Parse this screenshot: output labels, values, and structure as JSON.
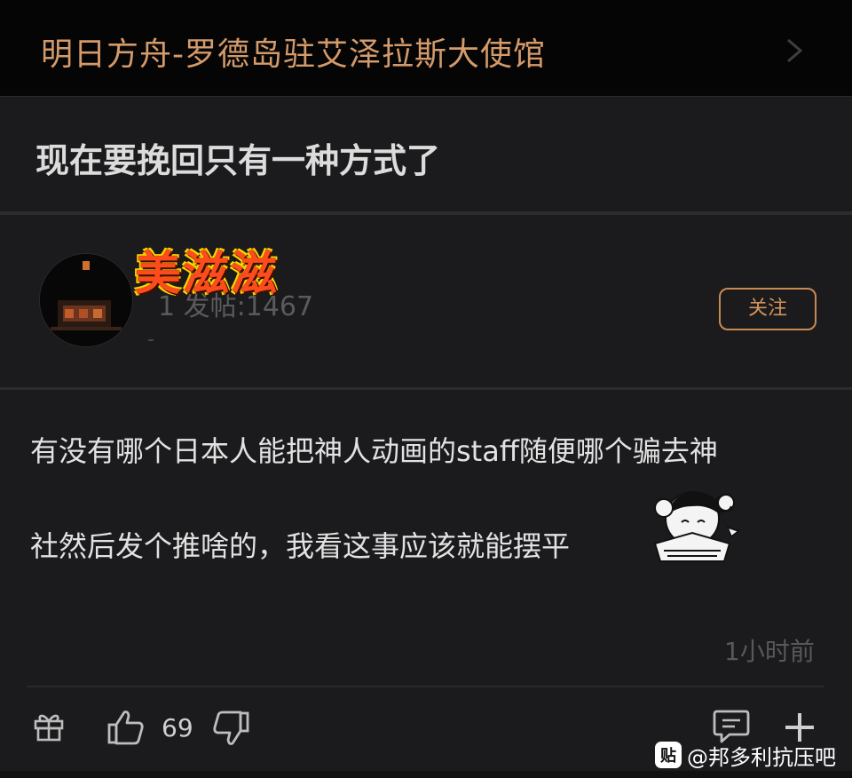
{
  "header": {
    "forum_title": "明日方舟-罗德岛驻艾泽拉斯大使馆",
    "chevron_icon": "chevron-right-icon"
  },
  "post": {
    "title": "现在要挽回只有一种方式了"
  },
  "author": {
    "name": "美滋滋",
    "meta": "1 发帖:1467",
    "submeta": "-",
    "follow_label": "关注"
  },
  "reply": {
    "lines": [
      "有没有哪个日本人能把神人动画的staff随便哪个骗去神",
      "社然后发个推啥的，我看这事应该就能摆平"
    ],
    "time": "1小时前",
    "likes": "69"
  },
  "actions": {
    "gift_icon": "gift-icon",
    "like_icon": "thumbs-up-icon",
    "dislike_icon": "thumbs-down-icon",
    "comment_icon": "comment-icon",
    "add_icon": "plus-icon"
  },
  "watermark": {
    "badge": "贴",
    "text": "@邦多利抗压吧"
  }
}
